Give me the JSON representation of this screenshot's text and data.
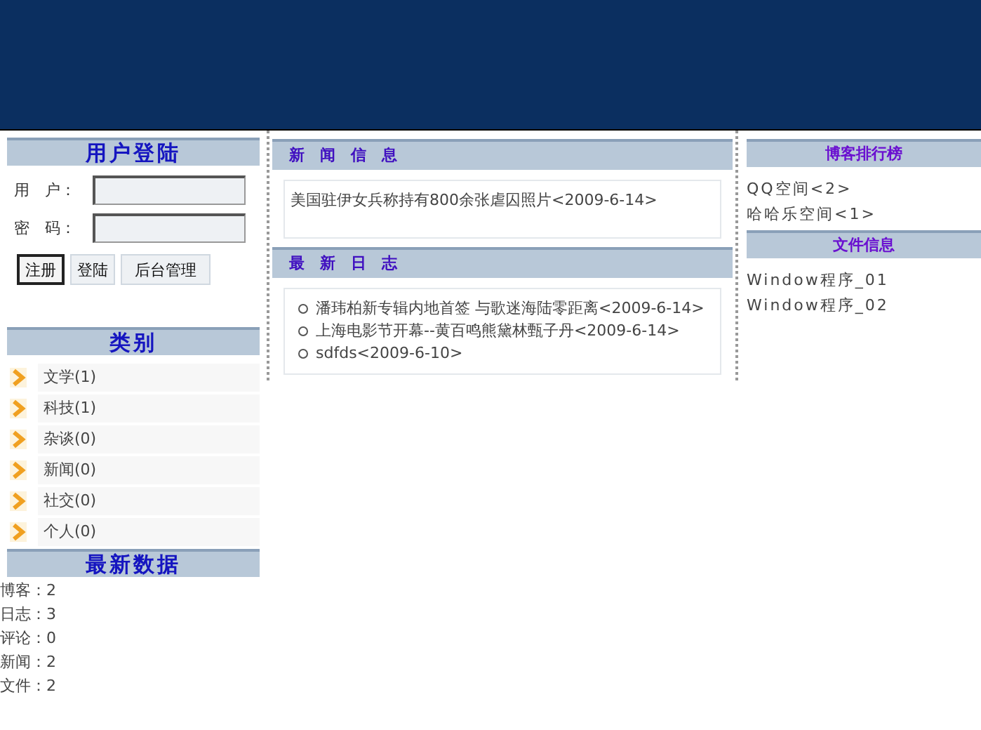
{
  "login": {
    "title": "用户登陆",
    "user_label": "用　户：",
    "password_label": "密　码：",
    "buttons": [
      {
        "label": "注册",
        "selected": true
      },
      {
        "label": "登陆",
        "selected": false
      },
      {
        "label": "后台管理",
        "selected": false
      }
    ]
  },
  "categories": {
    "title": "类别",
    "items": [
      "文学(1)",
      "科技(1)",
      "杂谈(0)",
      "新闻(0)",
      "社交(0)",
      "个人(0)"
    ]
  },
  "latest_data": {
    "title": "最新数据",
    "items": [
      "博客：2",
      "日志：3",
      "评论：0",
      "新闻：2",
      "文件：2"
    ]
  },
  "news": {
    "title": "新　闻　信　息",
    "items": [
      "美国驻伊女兵称持有800余张虐囚照片<2009-6-14>"
    ]
  },
  "logs": {
    "title": "最　新　日　志",
    "items": [
      "潘玮柏新专辑内地首签  与歌迷海陆零距离<2009-6-14>",
      "上海电影节开幕--黄百鸣熊黛林甄子丹<2009-6-14>",
      "sdfds<2009-6-10>"
    ]
  },
  "blog_ranking": {
    "title": "博客排行榜",
    "items": [
      "QQ空间<2>",
      "哈哈乐空间<1>"
    ]
  },
  "files": {
    "title": "文件信息",
    "items": [
      "Window程序_01",
      "Window程序_02"
    ]
  }
}
